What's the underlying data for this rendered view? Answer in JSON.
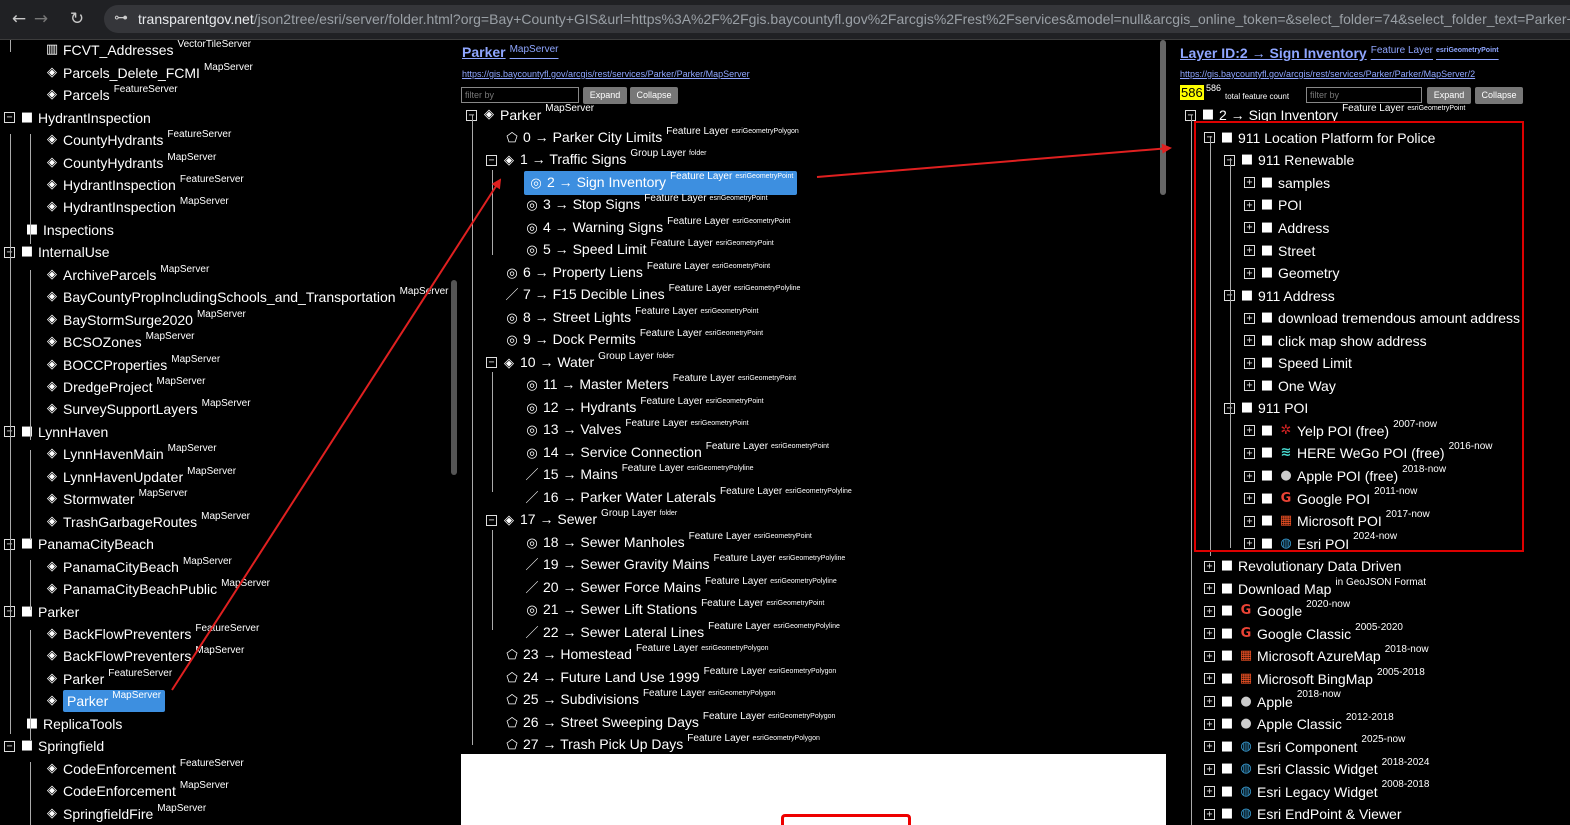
{
  "browser": {
    "back_icon": "←",
    "forward_icon": "→",
    "reload_icon": "↻",
    "site_info_icon": "⊶",
    "url_host": "transparentgov.net",
    "url_rest": "/json2tree/esri/server/folder.html?org=Bay+County+GIS&url=https%3A%2F%2Fgis.baycountyfl.gov%2Farcgis%2Frest%2Fservices&model=null&arcgis_online_token=&select_folder=74&select_folder_text=Parker+"
  },
  "col1": {
    "rows": [
      {
        "label": "FCVT_Addresses",
        "sup": "VectorTileServer",
        "type": "vt",
        "indent": 2
      },
      {
        "label": "Parcels_Delete_FCMI",
        "sup": "MapServer",
        "type": "svc",
        "indent": 2
      },
      {
        "label": "Parcels",
        "sup": "FeatureServer",
        "type": "svc",
        "indent": 2
      },
      {
        "label": "HydrantInspection",
        "sup": "",
        "type": "folder-open",
        "indent": 0
      },
      {
        "label": "CountyHydrants",
        "sup": "FeatureServer",
        "type": "svc",
        "indent": 2
      },
      {
        "label": "CountyHydrants",
        "sup": "MapServer",
        "type": "svc",
        "indent": 2
      },
      {
        "label": "HydrantInspection",
        "sup": "FeatureServer",
        "type": "svc",
        "indent": 2
      },
      {
        "label": "HydrantInspection",
        "sup": "MapServer",
        "type": "svc",
        "indent": 2
      },
      {
        "label": "Inspections",
        "sup": "",
        "type": "folder",
        "indent": 1
      },
      {
        "label": "InternalUse",
        "sup": "",
        "type": "folder-open",
        "indent": 0
      },
      {
        "label": "ArchiveParcels",
        "sup": "MapServer",
        "type": "svc",
        "indent": 2
      },
      {
        "label": "BayCountyPropIncludingSchools_and_Transportation",
        "sup": "MapServer",
        "type": "svc",
        "indent": 2
      },
      {
        "label": "BayStormSurge2020",
        "sup": "MapServer",
        "type": "svc",
        "indent": 2
      },
      {
        "label": "BCSOZones",
        "sup": "MapServer",
        "type": "svc",
        "indent": 2
      },
      {
        "label": "BOCCProperties",
        "sup": "MapServer",
        "type": "svc",
        "indent": 2
      },
      {
        "label": "DredgeProject",
        "sup": "MapServer",
        "type": "svc",
        "indent": 2
      },
      {
        "label": "SurveySupportLayers",
        "sup": "MapServer",
        "type": "svc",
        "indent": 2
      },
      {
        "label": "LynnHaven",
        "sup": "",
        "type": "folder-open",
        "indent": 0
      },
      {
        "label": "LynnHavenMain",
        "sup": "MapServer",
        "type": "svc",
        "indent": 2
      },
      {
        "label": "LynnHavenUpdater",
        "sup": "MapServer",
        "type": "svc",
        "indent": 2
      },
      {
        "label": "Stormwater",
        "sup": "MapServer",
        "type": "svc",
        "indent": 2
      },
      {
        "label": "TrashGarbageRoutes",
        "sup": "MapServer",
        "type": "svc",
        "indent": 2
      },
      {
        "label": "PanamaCityBeach",
        "sup": "",
        "type": "folder-open",
        "indent": 0
      },
      {
        "label": "PanamaCityBeach",
        "sup": "MapServer",
        "type": "svc",
        "indent": 2
      },
      {
        "label": "PanamaCityBeachPublic",
        "sup": "MapServer",
        "type": "svc",
        "indent": 2
      },
      {
        "label": "Parker",
        "sup": "",
        "type": "folder-open",
        "indent": 0
      },
      {
        "label": "BackFlowPreventers",
        "sup": "FeatureServer",
        "type": "svc",
        "indent": 2
      },
      {
        "label": "BackFlowPreventers",
        "sup": "MapServer",
        "type": "svc",
        "indent": 2
      },
      {
        "label": "Parker",
        "sup": "FeatureServer",
        "type": "svc",
        "indent": 2
      },
      {
        "label": "Parker",
        "sup": "MapServer",
        "type": "svc",
        "indent": 2,
        "selected": true
      },
      {
        "label": "ReplicaTools",
        "sup": "",
        "type": "folder",
        "indent": 1
      },
      {
        "label": "Springfield",
        "sup": "",
        "type": "folder-open",
        "indent": 0
      },
      {
        "label": "CodeEnforcement",
        "sup": "FeatureServer",
        "type": "svc",
        "indent": 2
      },
      {
        "label": "CodeEnforcement",
        "sup": "MapServer",
        "type": "svc",
        "indent": 2
      },
      {
        "label": "SpringfieldFire",
        "sup": "MapServer",
        "type": "svc",
        "indent": 2
      }
    ]
  },
  "col2": {
    "title": "Parker",
    "title_sup": "MapServer",
    "url": "https://gis.baycountyfl.gov/arcgis/rest/services/Parker/Parker/MapServer",
    "filter_placeholder": "filter by",
    "expand_label": "Expand",
    "collapse_label": "Collapse",
    "root": {
      "label": "Parker",
      "sup": "MapServer"
    },
    "layers": [
      {
        "label": "0 → Parker City Limits",
        "sup": "Feature Layer",
        "geom": "esriGeometryPolygon",
        "icon": "polygon",
        "indent": 1
      },
      {
        "label": "1 → Traffic Signs",
        "sup": "Group Layer",
        "geom": "folder",
        "icon": "group",
        "indent": 1,
        "open": true
      },
      {
        "label": "2 → Sign Inventory",
        "sup": "Feature Layer",
        "geom": "esriGeometryPoint",
        "icon": "point",
        "indent": 2,
        "selected": true
      },
      {
        "label": "3 → Stop Signs",
        "sup": "Feature Layer",
        "geom": "esriGeometryPoint",
        "icon": "point",
        "indent": 2
      },
      {
        "label": "4 → Warning Signs",
        "sup": "Feature Layer",
        "geom": "esriGeometryPoint",
        "icon": "point",
        "indent": 2
      },
      {
        "label": "5 → Speed Limit",
        "sup": "Feature Layer",
        "geom": "esriGeometryPoint",
        "icon": "point",
        "indent": 2
      },
      {
        "label": "6 → Property Liens",
        "sup": "Feature Layer",
        "geom": "esriGeometryPoint",
        "icon": "point",
        "indent": 1
      },
      {
        "label": "7 → F15 Decible Lines",
        "sup": "Feature Layer",
        "geom": "esriGeometryPolyline",
        "icon": "line",
        "indent": 1
      },
      {
        "label": "8 → Street Lights",
        "sup": "Feature Layer",
        "geom": "esriGeometryPoint",
        "icon": "point",
        "indent": 1
      },
      {
        "label": "9 → Dock Permits",
        "sup": "Feature Layer",
        "geom": "esriGeometryPoint",
        "icon": "point",
        "indent": 1
      },
      {
        "label": "10 → Water",
        "sup": "Group Layer",
        "geom": "folder",
        "icon": "group",
        "indent": 1,
        "open": true
      },
      {
        "label": "11 → Master Meters",
        "sup": "Feature Layer",
        "geom": "esriGeometryPoint",
        "icon": "point",
        "indent": 2
      },
      {
        "label": "12 → Hydrants",
        "sup": "Feature Layer",
        "geom": "esriGeometryPoint",
        "icon": "point",
        "indent": 2
      },
      {
        "label": "13 → Valves",
        "sup": "Feature Layer",
        "geom": "esriGeometryPoint",
        "icon": "point",
        "indent": 2
      },
      {
        "label": "14 → Service Connection",
        "sup": "Feature Layer",
        "geom": "esriGeometryPoint",
        "icon": "point",
        "indent": 2
      },
      {
        "label": "15 → Mains",
        "sup": "Feature Layer",
        "geom": "esriGeometryPolyline",
        "icon": "line",
        "indent": 2
      },
      {
        "label": "16 → Parker Water Laterals",
        "sup": "Feature Layer",
        "geom": "esriGeometryPolyline",
        "icon": "line",
        "indent": 2
      },
      {
        "label": "17 → Sewer",
        "sup": "Group Layer",
        "geom": "folder",
        "icon": "group",
        "indent": 1,
        "open": true
      },
      {
        "label": "18 → Sewer Manholes",
        "sup": "Feature Layer",
        "geom": "esriGeometryPoint",
        "icon": "point",
        "indent": 2
      },
      {
        "label": "19 → Sewer Gravity Mains",
        "sup": "Feature Layer",
        "geom": "esriGeometryPolyline",
        "icon": "line",
        "indent": 2
      },
      {
        "label": "20 → Sewer Force Mains",
        "sup": "Feature Layer",
        "geom": "esriGeometryPolyline",
        "icon": "line",
        "indent": 2
      },
      {
        "label": "21 → Sewer Lift Stations",
        "sup": "Feature Layer",
        "geom": "esriGeometryPoint",
        "icon": "point",
        "indent": 2
      },
      {
        "label": "22 → Sewer Lateral Lines",
        "sup": "Feature Layer",
        "geom": "esriGeometryPolyline",
        "icon": "line",
        "indent": 2
      },
      {
        "label": "23 → Homestead",
        "sup": "Feature Layer",
        "geom": "esriGeometryPolygon",
        "icon": "polygon",
        "indent": 1
      },
      {
        "label": "24 → Future Land Use 1999",
        "sup": "Feature Layer",
        "geom": "esriGeometryPolygon",
        "icon": "polygon",
        "indent": 1
      },
      {
        "label": "25 → Subdivisions",
        "sup": "Feature Layer",
        "geom": "esriGeometryPolygon",
        "icon": "polygon",
        "indent": 1
      },
      {
        "label": "26 → Street Sweeping Days",
        "sup": "Feature Layer",
        "geom": "esriGeometryPolygon",
        "icon": "polygon",
        "indent": 1
      },
      {
        "label": "27 → Trash Pick Up Days",
        "sup": "Feature Layer",
        "geom": "esriGeometryPolygon",
        "icon": "polygon",
        "indent": 1
      }
    ]
  },
  "col3": {
    "title": "Layer ID:2 → Sign Inventory",
    "title_sup1": "Feature Layer",
    "title_sup2": "esriGeometryPoint",
    "url": "https://gis.baycountyfl.gov/arcgis/rest/services/Parker/Parker/MapServer/2",
    "count": "586",
    "count_small": "586",
    "count_label": "total feature count",
    "filter_placeholder": "filter by",
    "expand_label": "Expand",
    "collapse_label": "Collapse",
    "root": {
      "label": "2 → Sign Inventory",
      "sup": "Feature Layer",
      "geom": "esriGeometryPoint"
    },
    "items": [
      {
        "label": "911 Location Platform for Police",
        "sup": "",
        "indent": 1,
        "open": true
      },
      {
        "label": "911 Renewable",
        "sup": "",
        "indent": 2,
        "open": true
      },
      {
        "label": "samples",
        "sup": "",
        "indent": 3
      },
      {
        "label": "POI",
        "sup": "",
        "indent": 3
      },
      {
        "label": "Address",
        "sup": "",
        "indent": 3
      },
      {
        "label": "Street",
        "sup": "",
        "indent": 3
      },
      {
        "label": "Geometry",
        "sup": "",
        "indent": 3
      },
      {
        "label": "911 Address",
        "sup": "",
        "indent": 2,
        "open": true
      },
      {
        "label": "download tremendous amount address",
        "sup": "",
        "indent": 3
      },
      {
        "label": "click map show address",
        "sup": "",
        "indent": 3
      },
      {
        "label": "Speed Limit",
        "sup": "",
        "indent": 3
      },
      {
        "label": "One Way",
        "sup": "",
        "indent": 3
      },
      {
        "label": "911 POI",
        "sup": "",
        "indent": 2,
        "open": true
      },
      {
        "label": "Yelp POI (free)",
        "sup": "2007-now",
        "indent": 3,
        "brand": "yelp"
      },
      {
        "label": "HERE WeGo POI (free)",
        "sup": "2016-now",
        "indent": 3,
        "brand": "here"
      },
      {
        "label": "Apple POI (free)",
        "sup": "2018-now",
        "indent": 3,
        "brand": "apple"
      },
      {
        "label": "Google POI",
        "sup": "2011-now",
        "indent": 3,
        "brand": "google"
      },
      {
        "label": "Microsoft POI",
        "sup": "2017-now",
        "indent": 3,
        "brand": "microsoft"
      },
      {
        "label": "Esri POI",
        "sup": "2024-now",
        "indent": 3,
        "brand": "esri"
      },
      {
        "label": "Revolutionary Data Driven",
        "sup": "",
        "indent": 1
      },
      {
        "label": "Download Map",
        "sup": "in GeoJSON Format",
        "indent": 1
      },
      {
        "label": "Google",
        "sup": "2020-now",
        "indent": 1,
        "brand": "google"
      },
      {
        "label": "Google Classic",
        "sup": "2005-2020",
        "indent": 1,
        "brand": "google"
      },
      {
        "label": "Microsoft AzureMap",
        "sup": "2018-now",
        "indent": 1,
        "brand": "microsoft"
      },
      {
        "label": "Microsoft BingMap",
        "sup": "2005-2018",
        "indent": 1,
        "brand": "microsoft"
      },
      {
        "label": "Apple",
        "sup": "2018-now",
        "indent": 1,
        "brand": "apple"
      },
      {
        "label": "Apple Classic",
        "sup": "2012-2018",
        "indent": 1,
        "brand": "apple"
      },
      {
        "label": "Esri Component",
        "sup": "2025-now",
        "indent": 1,
        "brand": "esri"
      },
      {
        "label": "Esri Classic Widget",
        "sup": "2018-2024",
        "indent": 1,
        "brand": "esri"
      },
      {
        "label": "Esri Legacy Widget",
        "sup": "2008-2018",
        "indent": 1,
        "brand": "esri"
      },
      {
        "label": "Esri EndPoint & Viewer",
        "sup": "",
        "indent": 1,
        "brand": "esri"
      }
    ]
  },
  "colors": {
    "selected": "#3d8fe0",
    "link": "#8fa6ff",
    "arrow": "#e02020",
    "count_bg": "#ffff00"
  }
}
